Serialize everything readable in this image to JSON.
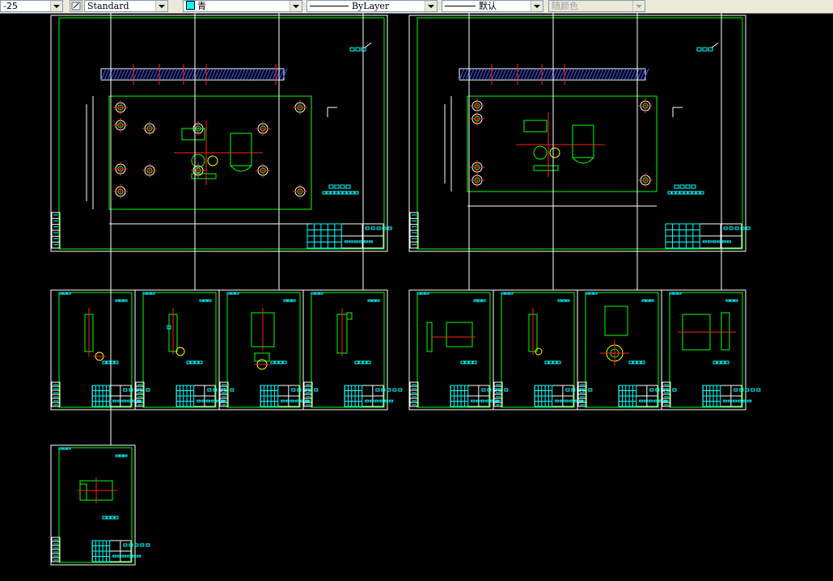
{
  "toolbar": {
    "dimstyle_value": "-25",
    "textstyle_value": "Standard",
    "color_value": "青",
    "linetype_value": "ByLayer",
    "lineweight_value": "默认",
    "plotstyle_value": "随颜色"
  },
  "colors": {
    "background": "#000000",
    "frame": "#ffffff",
    "geometry": "#00ff00",
    "annotation": "#00ffff",
    "centerline": "#ff2020",
    "dimension": "#ffff00"
  }
}
